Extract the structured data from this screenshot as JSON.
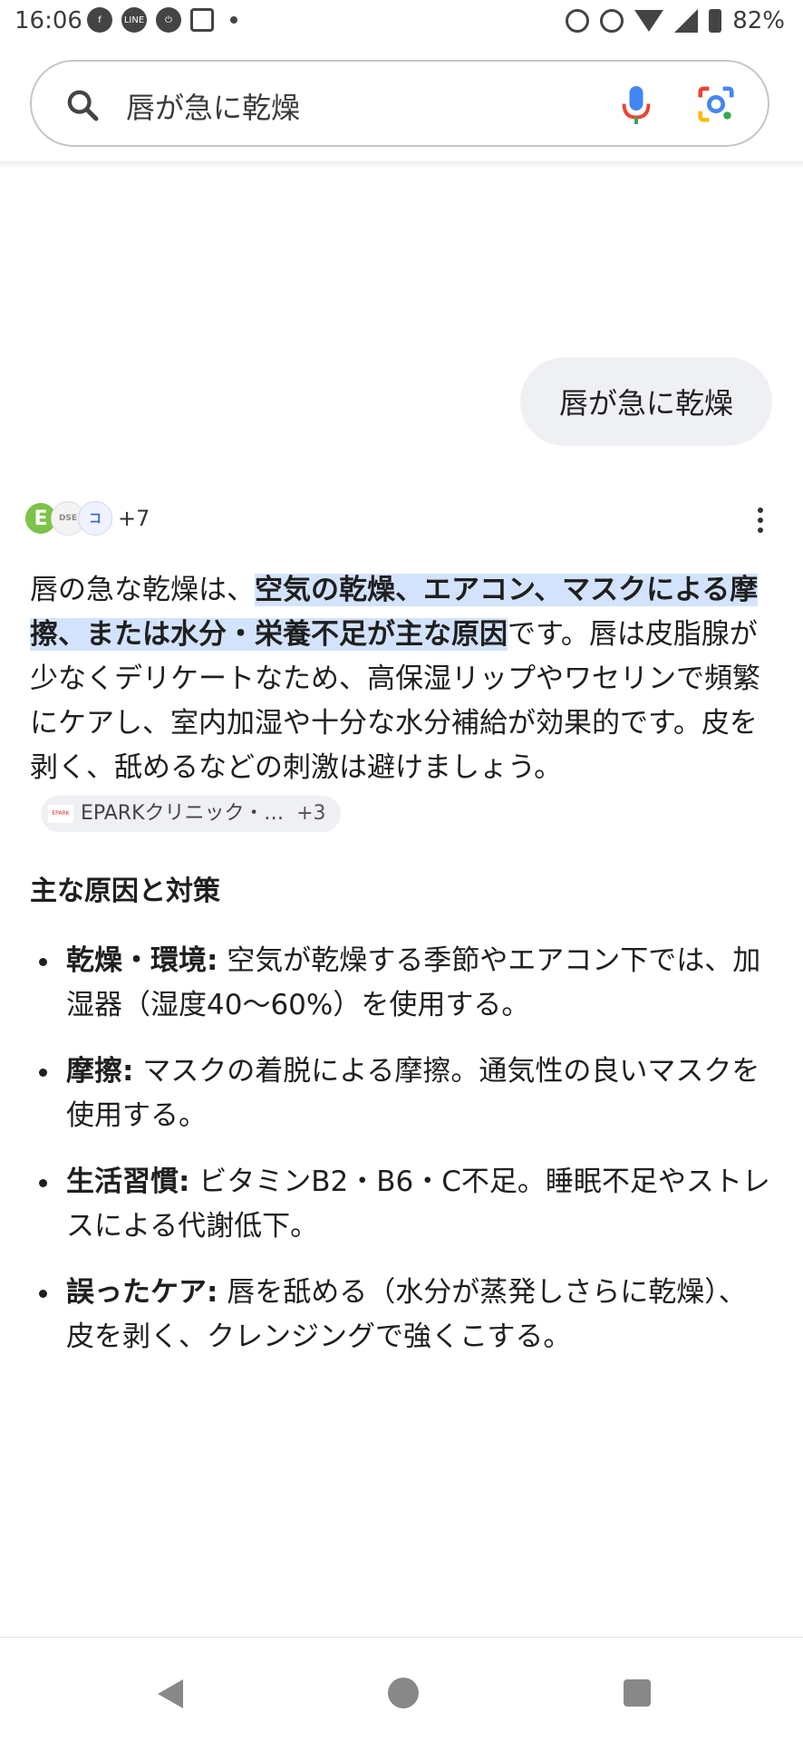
{
  "status_bar": {
    "time": "16:06",
    "battery": "82%"
  },
  "search": {
    "query": "唇が急に乾燥"
  },
  "conversation": {
    "user_query": "唇が急に乾燥",
    "sources_more": "+7"
  },
  "answer": {
    "intro_before": "唇の急な乾燥は、",
    "intro_highlight": "空気の乾燥、エアコン、マスクによる摩擦、または水分・栄養不足が主な原因",
    "intro_after": "です。唇は皮脂腺が少なくデリケートなため、高保湿リップやワセリンで頻繁にケアし、室内加湿や十分な水分補給が効果的です。皮を剥く、舐めるなどの刺激は避けましょう。",
    "citation_chip": {
      "label": "EPARKクリニック・…",
      "count": "+3"
    }
  },
  "section": {
    "title": "主な原因と対策",
    "items": [
      {
        "term": "乾燥・環境:",
        "text": " 空気が乾燥する季節やエアコン下では、加湿器（湿度40〜60%）を使用する。"
      },
      {
        "term": "摩擦:",
        "text": " マスクの着脱による摩擦。通気性の良いマスクを使用する。"
      },
      {
        "term": "生活習慣:",
        "text": " ビタミンB2・B6・C不足。睡眠不足やストレスによる代謝低下。"
      },
      {
        "term": "誤ったケア:",
        "text": " 唇を舐める（水分が蒸発しさらに乾燥）、皮を剥く、クレンジングで強くこする。"
      }
    ]
  }
}
